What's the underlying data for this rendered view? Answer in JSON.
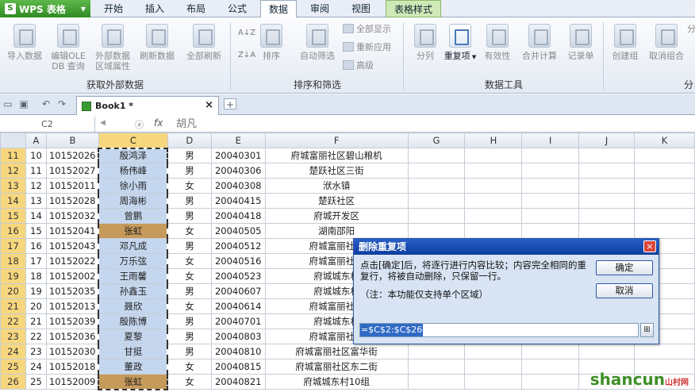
{
  "app": {
    "name": "WPS 表格"
  },
  "menu": {
    "tabs": [
      "开始",
      "插入",
      "布局",
      "公式",
      "数据",
      "审阅",
      "视图",
      "表格样式"
    ]
  },
  "ribbon": {
    "external": [
      "导入数据",
      "编辑OLE\nDB 查询",
      "外部数据\n区域属性",
      "刷新数据",
      "全部刷新"
    ],
    "sort": [
      "排序"
    ],
    "filter": [
      "自动筛选"
    ],
    "filter_small": [
      "全部显示",
      "重新应用",
      "高级"
    ],
    "tools": [
      "分列",
      "重复项",
      "有效性",
      "合并计算",
      "记录单"
    ],
    "outline": [
      "创建组",
      "取消组合",
      "分"
    ],
    "groups": [
      "获取外部数据",
      "排序和筛选",
      "数据工具",
      "分"
    ]
  },
  "doc": {
    "tab_label": "Book1 *",
    "close": "×"
  },
  "formula": {
    "name_box": "C2",
    "fx": "fx",
    "value": "胡凡"
  },
  "sheet": {
    "columns": [
      "A",
      "B",
      "C",
      "D",
      "E",
      "F",
      "G",
      "H",
      "I",
      "J",
      "K"
    ],
    "rows": [
      {
        "n": "11",
        "a": "10",
        "b": "10152026",
        "c": "殷鸿泽",
        "d": "男",
        "e": "20040301",
        "f": "府城富丽社区碧山粮机",
        "dup": false
      },
      {
        "n": "12",
        "a": "11",
        "b": "10152027",
        "c": "杨伟峰",
        "d": "男",
        "e": "20040306",
        "f": "楚跃社区三街",
        "dup": false
      },
      {
        "n": "13",
        "a": "12",
        "b": "10152011",
        "c": "徐小雨",
        "d": "女",
        "e": "20040308",
        "f": "洑水镇",
        "dup": false
      },
      {
        "n": "14",
        "a": "13",
        "b": "10152028",
        "c": "周海彬",
        "d": "男",
        "e": "20040415",
        "f": "楚跃社区",
        "dup": false
      },
      {
        "n": "15",
        "a": "14",
        "b": "10152032",
        "c": "曾鹏",
        "d": "男",
        "e": "20040418",
        "f": "府城开发区",
        "dup": false
      },
      {
        "n": "16",
        "a": "15",
        "b": "10152041",
        "c": "张虹",
        "d": "女",
        "e": "20040505",
        "f": "湖南邵阳",
        "dup": true
      },
      {
        "n": "17",
        "a": "16",
        "b": "10152043",
        "c": "邓凡成",
        "d": "男",
        "e": "20040512",
        "f": "府城富丽社区",
        "dup": false
      },
      {
        "n": "18",
        "a": "17",
        "b": "10152022",
        "c": "万乐弦",
        "d": "女",
        "e": "20040516",
        "f": "府城富丽社区",
        "dup": false
      },
      {
        "n": "19",
        "a": "18",
        "b": "10152002",
        "c": "王雨馨",
        "d": "女",
        "e": "20040523",
        "f": "府城城东村",
        "dup": false
      },
      {
        "n": "20",
        "a": "19",
        "b": "10152035",
        "c": "孙鑫玉",
        "d": "男",
        "e": "20040607",
        "f": "府城城东村",
        "dup": false
      },
      {
        "n": "21",
        "a": "20",
        "b": "10152013",
        "c": "聂欣",
        "d": "女",
        "e": "20040614",
        "f": "府城富丽社区",
        "dup": false
      },
      {
        "n": "22",
        "a": "21",
        "b": "10152039",
        "c": "殷陈博",
        "d": "男",
        "e": "20040701",
        "f": "府城城东村",
        "dup": false
      },
      {
        "n": "23",
        "a": "22",
        "b": "10152036",
        "c": "夏黎",
        "d": "男",
        "e": "20040803",
        "f": "府城富丽社区",
        "dup": false
      },
      {
        "n": "24",
        "a": "23",
        "b": "10152030",
        "c": "甘挺",
        "d": "男",
        "e": "20040810",
        "f": "府城富丽社区富华街",
        "dup": false
      },
      {
        "n": "25",
        "a": "24",
        "b": "10152018",
        "c": "董政",
        "d": "女",
        "e": "20040815",
        "f": "府城富丽社区东二街",
        "dup": false
      },
      {
        "n": "26",
        "a": "25",
        "b": "10152009",
        "c": "张虹",
        "d": "女",
        "e": "20040821",
        "f": "府城城东村10组",
        "dup": true
      }
    ]
  },
  "dialog": {
    "title": "删除重复项",
    "close": "×",
    "message": "点击[确定]后，将逐行进行内容比较；内容完全相同的重复行，将被自动删除，只保留一行。",
    "note": "（注：本功能仅支持单个区域）",
    "ok": "确定",
    "cancel": "取消",
    "range": "=$C$2:$C$26"
  },
  "watermark": {
    "text": "shancun",
    "sub": "山村网"
  },
  "colors": {
    "duplicate_fill": "#c59a5b",
    "selection_fill": "#c5d7ee",
    "row_header": "#f7d77e"
  }
}
